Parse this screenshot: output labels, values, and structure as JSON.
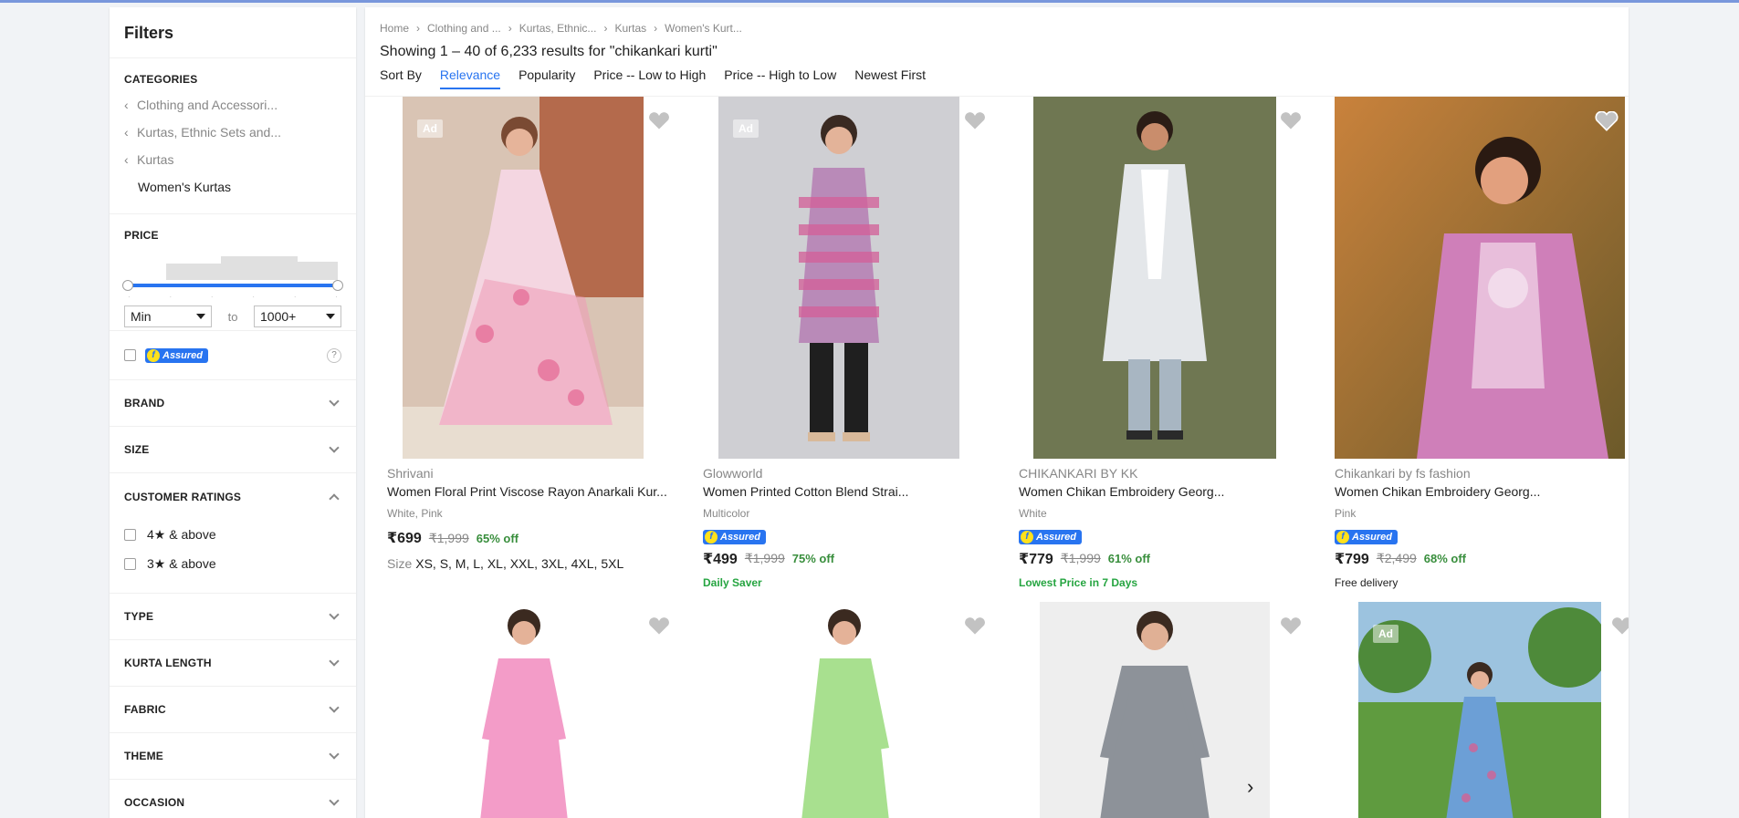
{
  "colors": {
    "accent": "#2874f0",
    "green": "#388e3c",
    "bg": "#f1f3f6"
  },
  "filters": {
    "title": "Filters",
    "categories": {
      "heading": "CATEGORIES",
      "items": [
        "Clothing and Accessori...",
        "Kurtas, Ethnic Sets and...",
        "Kurtas"
      ],
      "current": "Women's Kurtas"
    },
    "price": {
      "heading": "PRICE",
      "min": "Min",
      "to": "to",
      "max": "1000+"
    },
    "assured": {
      "badge": "Assured",
      "help": "?"
    },
    "brand": "BRAND",
    "size": "SIZE",
    "ratings": {
      "heading": "CUSTOMER RATINGS",
      "options": [
        "4★ & above",
        "3★ & above"
      ]
    },
    "type": "TYPE",
    "kurta_length": "KURTA LENGTH",
    "fabric": "FABRIC",
    "theme": "THEME",
    "occasion": "OCCASION"
  },
  "breadcrumbs": [
    "Home",
    "Clothing and ...",
    "Kurtas, Ethnic...",
    "Kurtas",
    "Women's Kurt..."
  ],
  "results": "Showing 1 – 40 of 6,233 results for \"chikankari kurti\"",
  "sort": {
    "label": "Sort By",
    "options": [
      "Relevance",
      "Popularity",
      "Price -- Low to High",
      "Price -- High to Low",
      "Newest First"
    ],
    "active": "Relevance"
  },
  "products": [
    {
      "brand": "Shrivani",
      "title": "Women Floral Print Viscose Rayon Anarkali Kur...",
      "color": "White, Pink",
      "price": "₹699",
      "mrp": "₹1,999",
      "off": "65% off",
      "sizes_label": "Size",
      "sizes": "XS, S, M, L, XL, XXL, 3XL, 4XL, 5XL",
      "ad": "Ad"
    },
    {
      "brand": "Glowworld",
      "title": "Women Printed Cotton Blend Strai...",
      "color": "Multicolor",
      "assured": "Assured",
      "price": "₹499",
      "mrp": "₹1,999",
      "off": "75% off",
      "tag": "Daily Saver",
      "ad": "Ad"
    },
    {
      "brand": "CHIKANKARI BY KK",
      "title": "Women Chikan Embroidery Georg...",
      "color": "White",
      "assured": "Assured",
      "price": "₹779",
      "mrp": "₹1,999",
      "off": "61% off",
      "tag": "Lowest Price in 7 Days"
    },
    {
      "brand": "Chikankari by fs fashion",
      "title": "Women Chikan Embroidery Georg...",
      "color": "Pink",
      "assured": "Assured",
      "price": "₹799",
      "mrp": "₹2,499",
      "off": "68% off",
      "tag": "Free delivery"
    },
    {
      "ad": ""
    },
    {
      "ad": ""
    },
    {
      "ad": ""
    },
    {
      "ad": "Ad"
    }
  ]
}
